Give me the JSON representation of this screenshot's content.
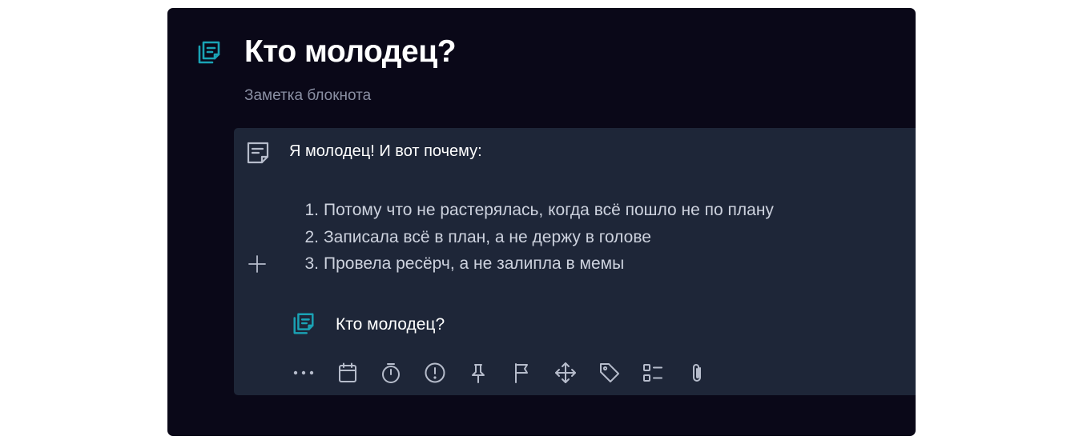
{
  "page": {
    "title": "Кто молодец?",
    "subtitle": "Заметка блокнота",
    "header_icon": "notebook-icon"
  },
  "note": {
    "icon": "note-icon",
    "heading": "Я молодец! И вот почему:",
    "items": [
      {
        "num": "1.",
        "text": "Потому что не растерялась, когда всё пошло не по плану"
      },
      {
        "num": "2.",
        "text": "Записала всё в план, а не держу в голове"
      },
      {
        "num": "3.",
        "text": "Провела ресёрч, а не залипла в мемы"
      }
    ],
    "add_icon": "plus-icon",
    "linked_notebook": {
      "icon": "notebook-icon",
      "label": "Кто молодец?"
    }
  },
  "toolbar": {
    "icons": [
      "more-icon",
      "calendar-icon",
      "timer-icon",
      "priority-icon",
      "pin-icon",
      "flag-icon",
      "move-icon",
      "tag-icon",
      "checklist-icon",
      "attachment-icon"
    ]
  },
  "colors": {
    "window_bg": "#0a0818",
    "card_bg": "#1e2638",
    "accent_teal": "#1aa3b5",
    "icon_gray": "#b6bccb",
    "subtitle_gray": "#8a8fa3"
  }
}
